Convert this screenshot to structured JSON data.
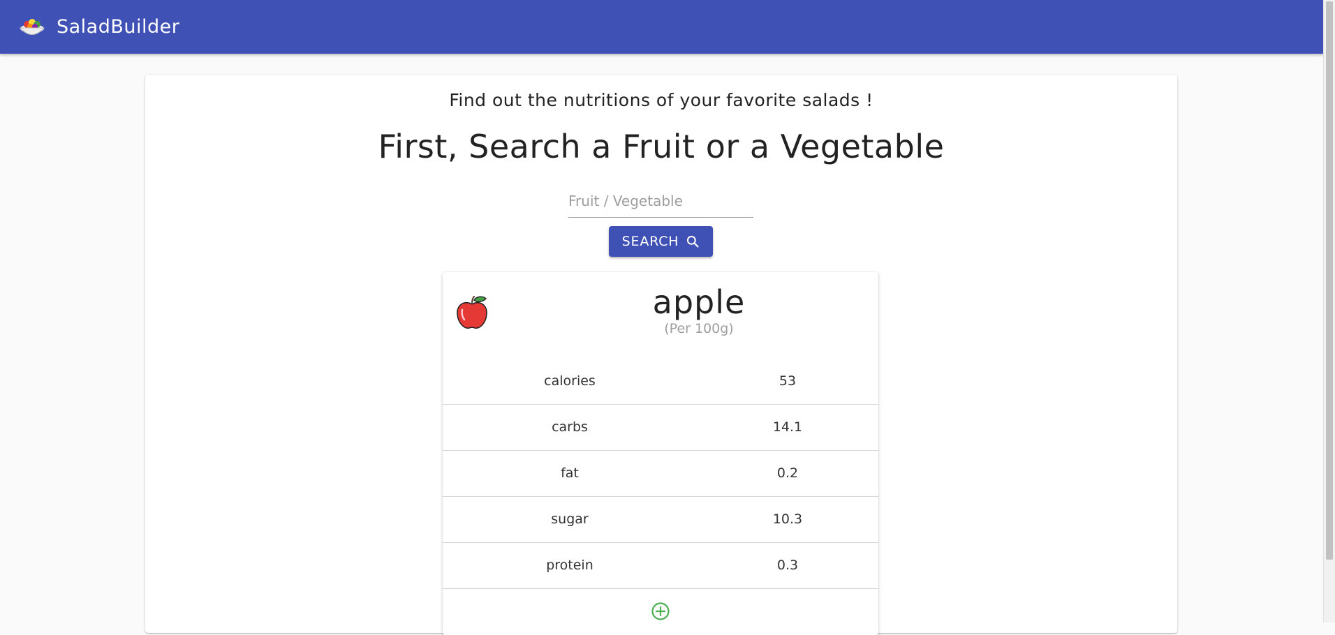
{
  "appbar": {
    "brand": "SaladBuilder",
    "logo_icon": "salad-bowl-icon",
    "background_color": "#3f51b5"
  },
  "main": {
    "tagline": "Find out the nutritions of your favorite salads !",
    "heading": "First, Search a Fruit or a Vegetable",
    "search": {
      "placeholder": "Fruit / Vegetable",
      "value": ""
    },
    "search_button": {
      "label": "SEARCH",
      "icon": "search-icon"
    }
  },
  "food_card": {
    "icon": "apple-icon",
    "name": "apple",
    "unit": "(Per 100g)",
    "nutrients": [
      {
        "name": "calories",
        "value": "53"
      },
      {
        "name": "carbs",
        "value": "14.1"
      },
      {
        "name": "fat",
        "value": "0.2"
      },
      {
        "name": "sugar",
        "value": "10.3"
      },
      {
        "name": "protein",
        "value": "0.3"
      }
    ],
    "add_button_icon": "add-circle-icon",
    "add_color": "#4caf50"
  }
}
